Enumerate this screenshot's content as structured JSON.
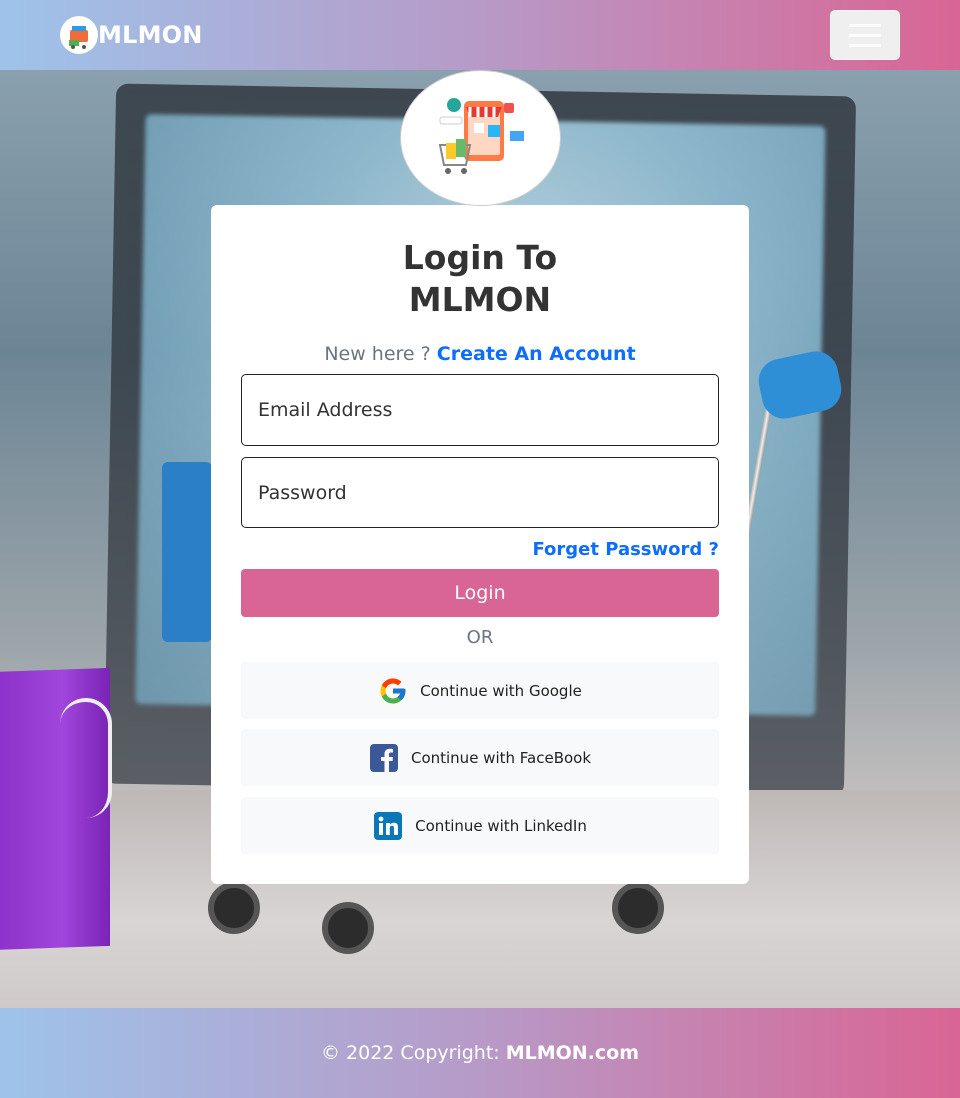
{
  "navbar": {
    "brand_text": "MLMON",
    "logo_icon": "shopping-logo-icon",
    "menu_icon": "hamburger-menu-icon"
  },
  "login": {
    "title_line1": "Login To",
    "title_line2": "MLMON",
    "new_here_text": "New here ?",
    "create_account_link": "Create An Account",
    "email_placeholder": "Email Address",
    "password_placeholder": "Password",
    "forgot_password_link": "Forget Password ?",
    "login_button": "Login",
    "or_text": "OR"
  },
  "social": {
    "google_label": "Continue with Google",
    "facebook_label": "Continue with FaceBook",
    "linkedin_label": "Continue with LinkedIn"
  },
  "footer": {
    "copyright_text": "© 2022 Copyright:",
    "site_name": "MLMON.com"
  },
  "colors": {
    "accent_pink": "#d96594",
    "link_blue": "#0d6efd",
    "gradient_start": "#9ec3ea",
    "gradient_end": "#d96594"
  }
}
